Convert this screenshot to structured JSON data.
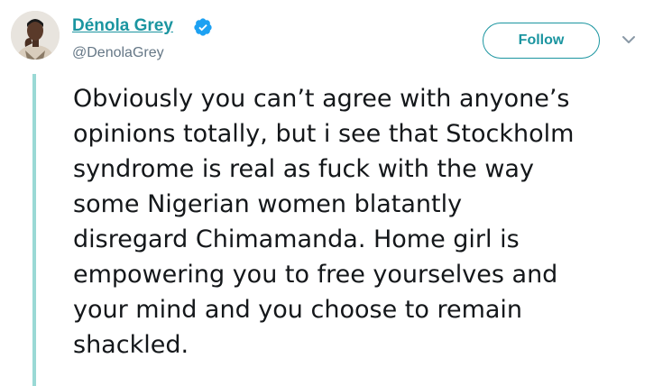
{
  "author": {
    "name": "Dénola Grey",
    "handle": "@DenolaGrey",
    "verified": true,
    "avatar_icon": "profile-photo-icon"
  },
  "actions": {
    "follow_label": "Follow",
    "menu_icon": "chevron-down-icon"
  },
  "tweet": {
    "lines": [
      "Obviously you can’t agree with anyone’s",
      "opinions totally, but i see that Stockholm",
      "syndrome is real as fuck with the way",
      "some Nigerian women blatantly",
      "disregard Chimamanda. Home girl is",
      "empowering you to free yourselves and",
      "your mind and you choose to remain",
      "shackled."
    ]
  },
  "colors": {
    "accent": "#1b95a0",
    "thread_line": "#9ad9d5",
    "text": "#14171a",
    "secondary_text": "#657786",
    "verified_badge": "#1da1f2"
  }
}
